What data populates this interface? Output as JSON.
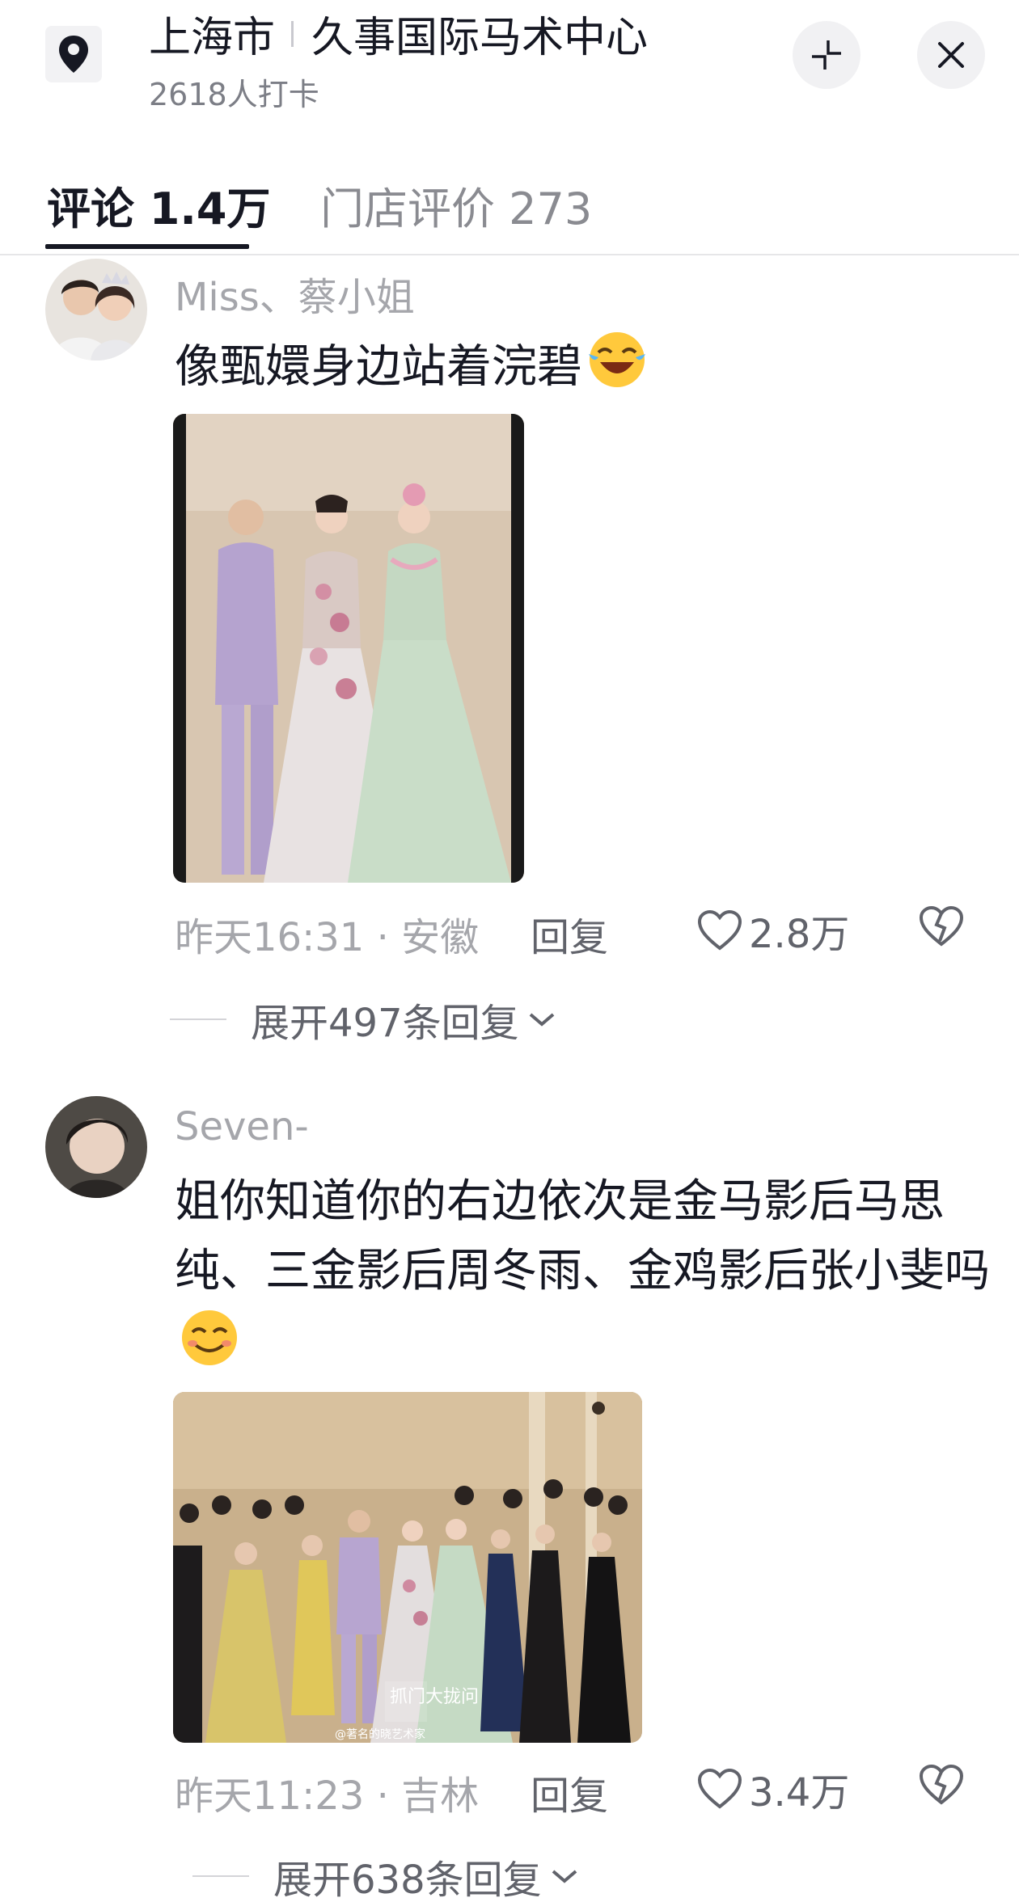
{
  "header": {
    "city": "上海市",
    "venue": "久事国际马术中心",
    "checkins": "2618人打卡",
    "icons": {
      "location": "location-pin-icon",
      "collapse": "collapse-icon",
      "close": "close-icon"
    }
  },
  "tabs": [
    {
      "label": "评论 1.4万",
      "active": true
    },
    {
      "label": "门店评价 273",
      "active": false
    }
  ],
  "comments": [
    {
      "username": "Miss、蔡小姐",
      "text": "像甄嬛身边站着浣碧",
      "emoji": "laughing-tears-emoji",
      "meta": "昨天16:31 · 安徽",
      "reply_label": "回复",
      "likes": "2.8万",
      "expand_label": "展开497条回复"
    },
    {
      "username": "Seven-",
      "text": "姐你知道你的右边依次是金马影后马思纯、三金影后周冬雨、金鸡影后张小斐吗",
      "emoji": "smiling-emoji",
      "meta": "昨天11:23 · 吉林",
      "reply_label": "回复",
      "likes": "3.4万",
      "expand_label": "展开638条回复",
      "photo_watermark": "@著名的晓艺术家",
      "photo_logo": "抓门大拢问"
    }
  ],
  "colors": {
    "primary_text": "#161823",
    "secondary_text": "#a5a6ab",
    "tab_underline": "#161823"
  }
}
